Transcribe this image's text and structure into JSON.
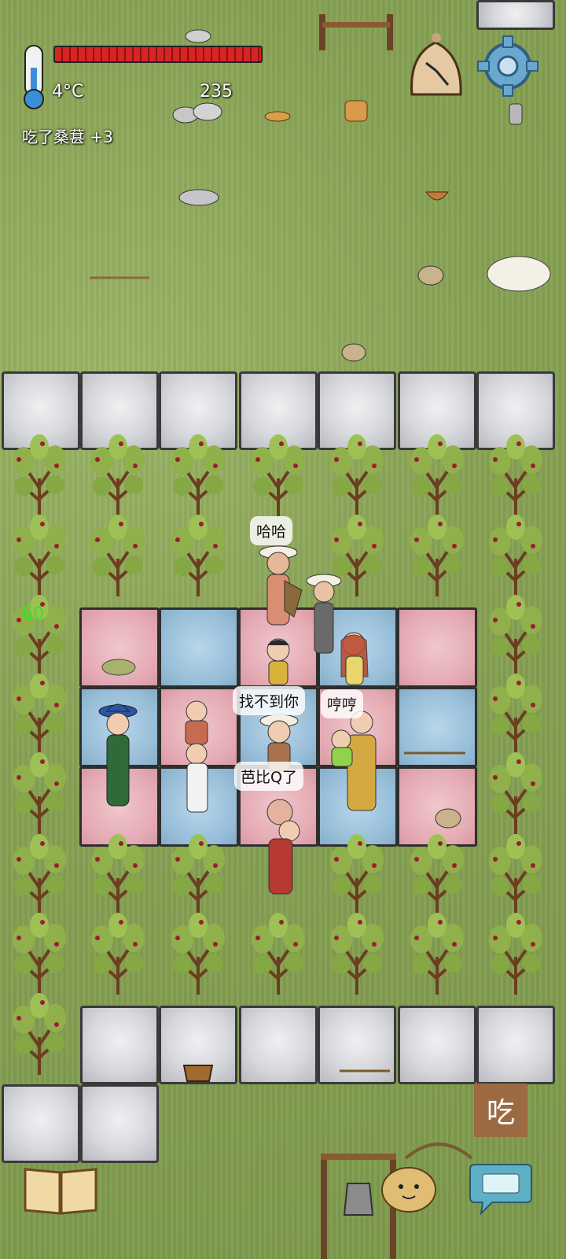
{
  "hud": {
    "temperature": "4°C",
    "food_counter": "235",
    "last_action": "吃了桑葚 +3",
    "yum_counter": "60"
  },
  "speech": {
    "haha": "哈哈",
    "cant_find_you": "找不到你",
    "humph": "哼哼",
    "barbecue": "芭比Q了"
  },
  "buttons": {
    "eat": "吃"
  },
  "colors": {
    "grass": "#86a154",
    "health": "#d72424",
    "floor_pink": "#e4aab3",
    "floor_blue": "#97bdd8",
    "eat_button": "#9c6a42",
    "yum_counter": "#2ee81e"
  },
  "icons": [
    "thermometer-icon",
    "gear-icon",
    "compass-icon",
    "bell-icon",
    "book-icon",
    "keyboard-icon",
    "potato-emote-icon"
  ]
}
